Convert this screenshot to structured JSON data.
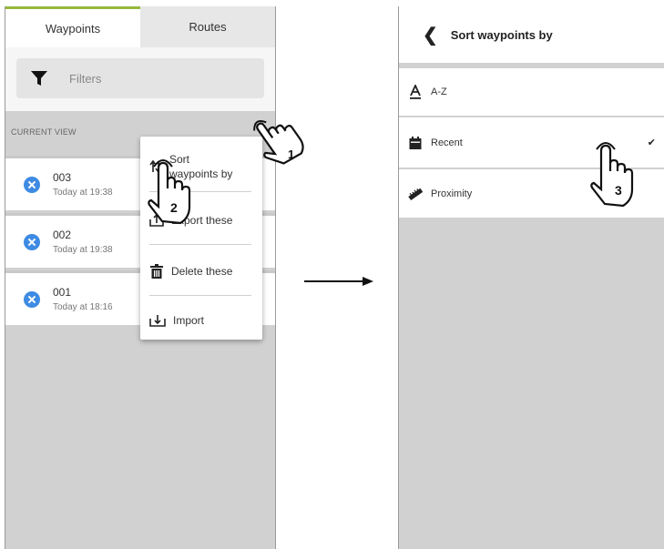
{
  "left_screen": {
    "tabs": [
      {
        "label": "Waypoints"
      },
      {
        "label": "Routes"
      }
    ],
    "filter": {
      "label": "Filters",
      "icon": "filter-icon"
    },
    "section_label": "CURRENT VIEW",
    "waypoints": [
      {
        "name": "003",
        "time": "Today at 19:38",
        "icon": "remove-icon"
      },
      {
        "name": "002",
        "time": "Today at 19:38",
        "icon": "remove-icon"
      },
      {
        "name": "001",
        "time": "Today at 18:16",
        "icon": "remove-icon"
      }
    ],
    "menu": {
      "sort_line1": "Sort",
      "sort_line2": "waypoints by",
      "export": "Export these",
      "delete": "Delete these",
      "import": "Import"
    }
  },
  "right_screen": {
    "title": "Sort waypoints by",
    "back_icon": "chevron-left-icon",
    "options": [
      {
        "label": "A-Z",
        "icon": "alphabet-icon",
        "selected": false
      },
      {
        "label": "Recent",
        "icon": "calendar-icon",
        "selected": true
      },
      {
        "label": "Proximity",
        "icon": "ruler-icon",
        "selected": false
      }
    ],
    "check_mark": "✔"
  },
  "annotations": {
    "step1": "1",
    "step2": "2",
    "step3": "3"
  },
  "colors": {
    "accent_tab": "#98b93b",
    "remove_icon": "#3d8be3",
    "empty_area": "#d1d1d1"
  }
}
